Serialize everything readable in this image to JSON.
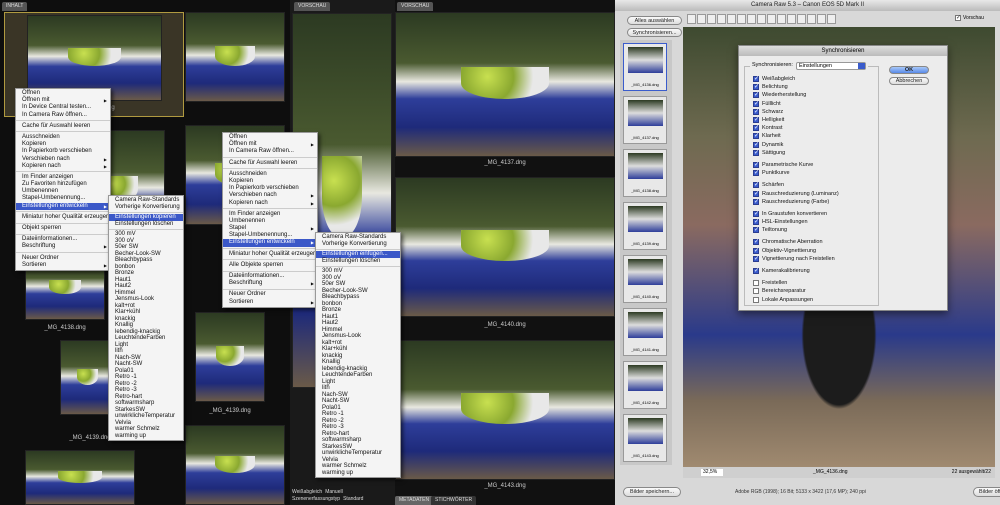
{
  "panels": {
    "inhalt_tab": "INHALT",
    "vorschau_tab_small": "VORSCHAU",
    "vorschau_tab": "VORSCHAU",
    "metadaten_tab": "METADATEN",
    "stichwoerter_tab": "STICHWÖRTER"
  },
  "thumbnails": {
    "t1": "_MG_4136.dng",
    "t2": "_MG_4138.dng",
    "t3": "_MG_4139.dng",
    "t4": "_MG_4139.dng",
    "p1": "_MG_4137.dng",
    "p2": "_MG_4140.dng",
    "p3": "_MG_4143.dng"
  },
  "metadata": {
    "r1": "Weißabgleich",
    "v1": "Manuell",
    "r2": "Szenenerfassungstyp",
    "v2": "Standard"
  },
  "menu1": [
    "Öffnen",
    "Öffnen mit",
    "In Device Central testen...",
    "In Camera Raw öffnen...",
    "-",
    "Cache für Auswahl leeren",
    "-",
    "Ausschneiden",
    "Kopieren",
    "In Papierkorb verschieben",
    "Verschieben nach",
    "Kopieren nach",
    "-",
    "Im Finder anzeigen",
    "Zu Favoriten hinzufügen",
    "Umbenennen",
    "Stapel-Umbenennung...",
    "Einstellungen entwickeln",
    "-",
    "Miniatur hoher Qualität erzeugen",
    "-",
    "Objekt sperren",
    "-",
    "Dateiinformationen...",
    "Beschriftung",
    "-",
    "Neuer Ordner",
    "Sortieren"
  ],
  "menu1_sub": [
    1,
    10,
    11,
    17,
    24,
    27
  ],
  "menu1_hl": 17,
  "sub1": [
    "Camera Raw-Standards",
    "Vorherige Konvertierung",
    "-",
    "Einstellungen kopieren",
    "Einstellungen löschen",
    "-",
    "300 mV",
    "300 oV",
    "50er SW",
    "Becher-Look-SW",
    "Bleachbypass",
    "bonbon",
    "Bronze",
    "Haut1",
    "Haut2",
    "Himmel",
    "Jensmus-Look",
    "kalt+rot",
    "Klar+kühl",
    "knackig",
    "Knallig",
    "lebendig-knackig",
    "LeuchtendeFarben",
    "Light",
    "lith",
    "Nach-SW",
    "Nacht-SW",
    "Pola01",
    "Retro -1",
    "Retro -2",
    "Retro -3",
    "Retro-hart",
    "softwarmsharp",
    "StarkesSW",
    "unwirklicheTemperatur",
    "Velvia",
    "warmer Schmelz",
    "warming up"
  ],
  "sub1_hl": 3,
  "menu2": [
    "Öffnen",
    "Öffnen mit",
    "In Camera Raw öffnen...",
    "-",
    "Cache für Auswahl leeren",
    "-",
    "Ausschneiden",
    "Kopieren",
    "In Papierkorb verschieben",
    "Verschieben nach",
    "Kopieren nach",
    "-",
    "Im Finder anzeigen",
    "Umbenennen",
    "Stapel",
    "Stapel-Umbenennung...",
    "Einstellungen entwickeln",
    "-",
    "Miniatur hoher Qualität erzeugen",
    "-",
    "Alle Objekte sperren",
    "-",
    "Dateiinformationen...",
    "Beschriftung",
    "-",
    "Neuer Ordner",
    "Sortieren"
  ],
  "menu2_sub": [
    1,
    9,
    10,
    14,
    16,
    23,
    26
  ],
  "menu2_hl": 16,
  "sub2": [
    "Camera Raw-Standards",
    "Vorherige Konvertierung",
    "-",
    "Einstellungen einfügen...",
    "Einstellungen löschen",
    "-",
    "300 mV",
    "300 oV",
    "50er SW",
    "Becher-Look-SW",
    "Bleachbypass",
    "bonbon",
    "Bronze",
    "Haut1",
    "Haut2",
    "Himmel",
    "Jensmus-Look",
    "kalt+rot",
    "Klar+kühl",
    "knackig",
    "Knallig",
    "lebendig-knackig",
    "LeuchtendeFarben",
    "Light",
    "lith",
    "Nach-SW",
    "Nacht-SW",
    "Pola01",
    "Retro -1",
    "Retro -2",
    "Retro -3",
    "Retro-hart",
    "softwarmsharp",
    "StarkesSW",
    "unwirklicheTemperatur",
    "Velvia",
    "warmer Schmelz",
    "warming up"
  ],
  "sub2_hl": 3,
  "camera_raw": {
    "title": "Camera Raw 5.3 – Canon EOS 5D Mark II",
    "select_all": "Alles auswählen",
    "sync": "Synchronisieren...",
    "preview_label": "Vorschau",
    "zoom": "32,5%",
    "filename": "_MG_4136.dng",
    "selected_count": "22 ausgewählt/22",
    "save": "Bilder speichern...",
    "info": "Adobe RGB (1998); 16 Bit; 5133 x 3422 (17,6 MP); 240 ppi",
    "open": "Bilder öffnen",
    "filmstrip": [
      "_MG_4136.dng",
      "_MG_4137.dng",
      "_MG_4138.dng",
      "_MG_4139.dng",
      "_MG_4140.dng",
      "_MG_4141.dng",
      "_MG_4142.dng",
      "_MG_4143.dng"
    ]
  },
  "dialog": {
    "title": "Synchronisieren",
    "sync_label": "Synchronisieren:",
    "sync_value": "Einstellungen",
    "ok": "OK",
    "cancel": "Abbrechen",
    "items": [
      [
        "Weißabgleich",
        1
      ],
      [
        "Belichtung",
        1
      ],
      [
        "Wiederherstellung",
        1
      ],
      [
        "Fülllicht",
        1
      ],
      [
        "Schwarz",
        1
      ],
      [
        "Helligkeit",
        1
      ],
      [
        "Kontrast",
        1
      ],
      [
        "Klarheit",
        1
      ],
      [
        "Dynamik",
        1
      ],
      [
        "Sättigung",
        1
      ],
      [
        "-"
      ],
      [
        "Parametrische Kurve",
        1
      ],
      [
        "Punktkurve",
        1
      ],
      [
        "-"
      ],
      [
        "Schärfen",
        1
      ],
      [
        "Rauschreduzierung (Luminanz)",
        1
      ],
      [
        "Rauschreduzierung (Farbe)",
        1
      ],
      [
        "-"
      ],
      [
        "In Graustufen konvertieren",
        1
      ],
      [
        "HSL-Einstellungen",
        1
      ],
      [
        "Teiltonung",
        1
      ],
      [
        "-"
      ],
      [
        "Chromatische Aberration",
        1
      ],
      [
        "Objektiv-Vignettierung",
        1
      ],
      [
        "Vignettierung nach Freistellen",
        1
      ],
      [
        "-"
      ],
      [
        "Kamerakalibrierung",
        1
      ],
      [
        "-"
      ],
      [
        "Freistellen",
        0
      ],
      [
        "Bereichsreparatur",
        0
      ],
      [
        "Lokale Anpassungen",
        0
      ]
    ]
  }
}
